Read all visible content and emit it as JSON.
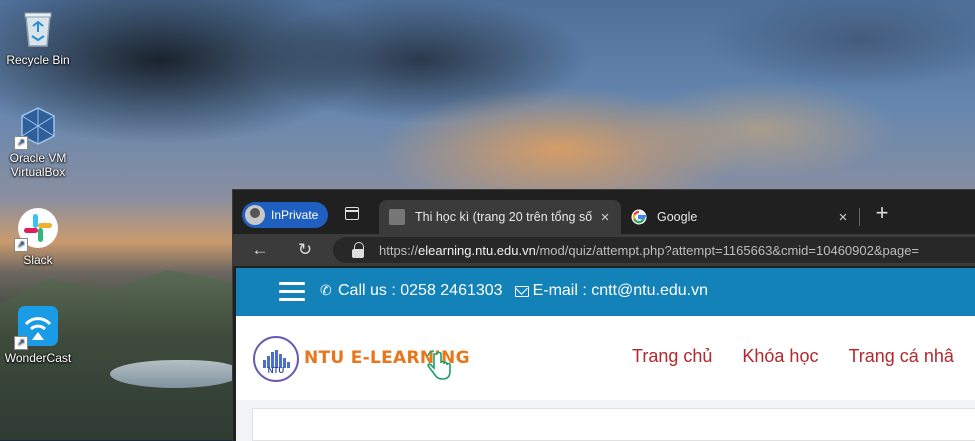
{
  "desktop": {
    "icons": [
      {
        "label": "Recycle Bin",
        "icon": "recycle-bin-icon"
      },
      {
        "label": "Oracle VM VirtualBox",
        "icon": "virtualbox-icon"
      },
      {
        "label": "Slack",
        "icon": "slack-icon"
      },
      {
        "label": "WonderCast",
        "icon": "wondercast-icon"
      }
    ]
  },
  "browser": {
    "inprivate_label": "InPrivate",
    "tabs": [
      {
        "title": "Thi học kì (trang 20 trên tổng số",
        "icon": "moodle-favicon",
        "active": true
      },
      {
        "title": "Google",
        "icon": "google-favicon",
        "active": false
      }
    ],
    "close_glyph": "×",
    "new_tab_glyph": "+",
    "back_glyph": "←",
    "refresh_glyph": "↻",
    "url": {
      "prefix": "https://",
      "host": "elearning.ntu.edu.vn",
      "path": "/mod/quiz/attempt.php?attempt=1165663&cmid=10460902&page="
    }
  },
  "page": {
    "contact": {
      "call_text": "Call us : 0258 2461303",
      "email_text": "E-mail : cntt@ntu.edu.vn"
    },
    "logo_seal_text": "NTU",
    "logo_text": "NTU E-LEARNING",
    "menu": [
      "Trang chủ",
      "Khóa học",
      "Trang cá nhâ"
    ]
  },
  "colors": {
    "topbar": "#1282b8",
    "menu_text": "#b3272d",
    "logo_text": "#e8761a",
    "inprivate": "#1f5fbf"
  }
}
